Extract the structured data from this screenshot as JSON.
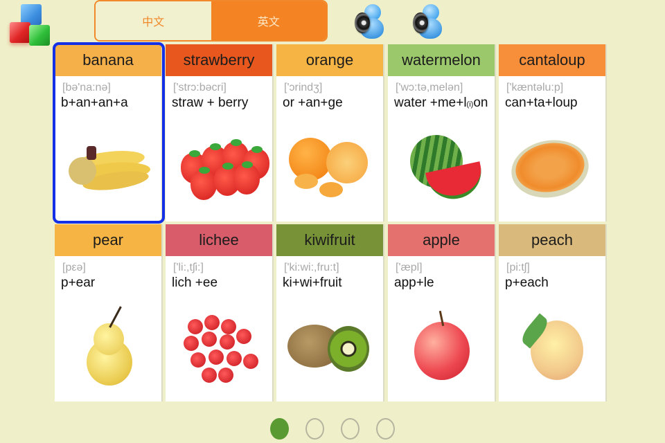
{
  "header": {
    "logo_icon": "building-blocks-icon",
    "language_toggle": {
      "options": [
        {
          "label": "中文",
          "active": false
        },
        {
          "label": "英文",
          "active": true
        }
      ]
    },
    "speakers": [
      {
        "icon": "speaker-person-icon",
        "name": "voice-1"
      },
      {
        "icon": "speaker-person-icon",
        "name": "voice-2"
      }
    ]
  },
  "cards": [
    {
      "word": "banana",
      "phonetic": "[bə'na:nə]",
      "split": "b+an+an+a",
      "color": "#f5b04a",
      "selected": true
    },
    {
      "word": "strawberry",
      "phonetic": "['strɔ:bəcri]",
      "split": "straw  + berry",
      "color": "#e8581e",
      "selected": false
    },
    {
      "word": "orange",
      "phonetic": "['ɔrindʒ]",
      "split": "or +an+ge",
      "color": "#f5b443",
      "selected": false
    },
    {
      "word": "watermelon",
      "phonetic": "['wɔ:tə,melən]",
      "split_main": "water +me+l",
      "split_small": "(i)",
      "split_end": "on",
      "color": "#9bc86b",
      "selected": false
    },
    {
      "word": "cantaloup",
      "phonetic": "['kæntəlu:p]",
      "split": "can+ta+loup",
      "color": "#f68e3a",
      "selected": false
    },
    {
      "word": "pear",
      "phonetic": "[pεə]",
      "split": "p+ear",
      "color": "#f5b443",
      "selected": false
    },
    {
      "word": "lichee",
      "phonetic": "['li:,tʃi:]",
      "split": "lich +ee",
      "color": "#d85c6a",
      "selected": false
    },
    {
      "word": "kiwifruit",
      "phonetic": "['ki:wi:,fru:t]",
      "split": "ki+wi+fruit",
      "color": "#779237",
      "selected": false
    },
    {
      "word": "apple",
      "phonetic": "['æpl]",
      "split": "app+le",
      "color": "#e4716d",
      "selected": false
    },
    {
      "word": "peach",
      "phonetic": "[pi:tʃ]",
      "split": "p+each",
      "color": "#d9ba7c",
      "selected": false
    }
  ],
  "pager": {
    "total": 4,
    "current": 1
  }
}
